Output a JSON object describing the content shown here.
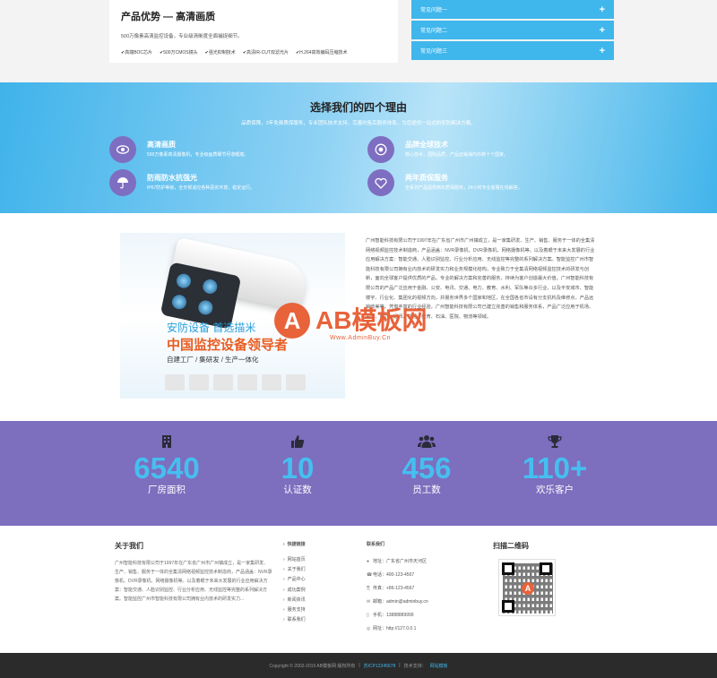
{
  "advantages": {
    "title": "产品优势 — 高清画质",
    "description": "500万像素高清监控设备，专业级清晰度全面捕捉细节。",
    "features": [
      "高端BOC芯片",
      "500万CMOS镜头",
      "强光抑制技术",
      "高清IR-CUT双滤光片",
      "H.264高效编码压缩技术"
    ]
  },
  "accordion": {
    "items": [
      {
        "label": "常见问题一",
        "icon": "plus-icon"
      },
      {
        "label": "常见问题二",
        "icon": "plus-icon"
      },
      {
        "label": "常见问题三",
        "icon": "plus-icon"
      }
    ]
  },
  "reasons": {
    "title": "选择我们的四个理由",
    "subtitle": "品质保障，2年免费质保服务，专业团队技术支持，完善的售后服务体系，为您提供一站式的安防解决方案。",
    "items": [
      {
        "title": "高清画质",
        "desc": "500万像素高清摄像机，专业级画质细节尽收眼底。",
        "icon": "eye-icon"
      },
      {
        "title": "品牌全球技术",
        "desc": "核心技术，国际品质，产品远销海内外数十个国家。",
        "icon": "target-icon"
      },
      {
        "title": "防雨防水抗强光",
        "desc": "IP67防护等级，全天候适应各种恶劣环境，稳定运行。",
        "icon": "umbrella-icon"
      },
      {
        "title": "两年质保服务",
        "desc": "全系列产品提供两年质保服务，24小时专业客服在线解答。",
        "icon": "heart-icon"
      }
    ]
  },
  "about": {
    "ad_line1": "安防设备  首选描米",
    "ad_line2": "中国监控设备领导者",
    "ad_line3": "自建工厂 / 集研发 / 生产一体化",
    "text": "广州智能科技有限公司于1997年在广东省广州市广州镇成立，是一家集研发、生产、销售、服务于一体的全集清网络视频监控技术制造商，产品涵盖：NVR录像机、DVR录像机、网络摄像机等。以及着眼于未来大发展的行业应用解决方案：智能交通、人脸识别监控、行业分析应用、无线监控等完整的系列解决方案。智能监控广州市智能科技有限公司拥有业内技术的研发实力和业务规模化结构，专业致力于全集清网络视频监控技术的研发与创新，面向全球客户提供优质的产品、专业的解决方案和完善的服务，持续为客户创造最大价值。广州智能科技有限公司的产品广泛应用于金融、公安、电讯、交通、电力、教育、水利、军队等众多行业，以及平安城市、智能楼宇、行业化、集团化的视频方向，并服务世界多个国家和地区，在全国各省市设有分支机构及维修点，产品远销欧美等。凭借丰富的行业经验，广州智能科技有限公司已建立完善的销售和服务体系，产品广泛应用于机场、金融、电力、通讯、交通、教育、石油、医院、物流等领域。"
  },
  "watermark": {
    "logo_letter": "A",
    "brand": "AB模板网",
    "url": "Www.AdminBuy.Cn"
  },
  "stats": [
    {
      "number": "6540",
      "label": "厂房面积",
      "icon": "building-icon"
    },
    {
      "number": "10",
      "label": "认证数",
      "icon": "thumbs-up-icon"
    },
    {
      "number": "456",
      "label": "员工数",
      "icon": "users-icon"
    },
    {
      "number": "110+",
      "label": "欢乐客户",
      "icon": "trophy-icon"
    }
  ],
  "footer": {
    "about_title": "关于我们",
    "about_text": "广州智能科技有限公司于1997年在广东省广州市广州镇成立，是一家集研发、生产、销售、服务于一体的全集清网络视频监控技术制造商，产品涵盖：NVR录像机、DVR录像机、网络摄像机等。以及着眼于未来大发展的行业应用解决方案：智能交通、人脸识别监控、行业分析应用、无线监控等完整的系列解决方案。智能监控广州市智能科技有限公司拥有业内技术的研发实力...",
    "links_title": "快捷链接",
    "links": [
      "网站首页",
      "关于我们",
      "产品中心",
      "成功案例",
      "新闻资讯",
      "服务支持",
      "联系我们"
    ],
    "contact_title": "联系我们",
    "contact": [
      {
        "icon": "location-icon",
        "text": "地址：广东省广州市天河区"
      },
      {
        "icon": "phone-icon",
        "text": "电话：400-123-4567"
      },
      {
        "icon": "fax-icon",
        "text": "传真：+86-123-4567"
      },
      {
        "icon": "mail-icon",
        "text": "邮箱：admin@adminbuy.cn"
      },
      {
        "icon": "mobile-icon",
        "text": "手机：13888889999"
      },
      {
        "icon": "globe-icon",
        "text": "网址：http://127.0.0.1"
      }
    ],
    "qr_title": "扫描二维码",
    "qr_logo_letter": "A"
  },
  "copyright": {
    "text": "Copyright © 2002-2019 AB模板网 版权所有",
    "icp": "苏ICP12345678",
    "tech": "技术支持：",
    "tech_link": "网站模板"
  },
  "colors": {
    "accent_blue": "#3fb6ec",
    "accent_purple": "#7d6ebe",
    "stat_number": "#45bff0",
    "watermark_orange": "#e8623a"
  }
}
